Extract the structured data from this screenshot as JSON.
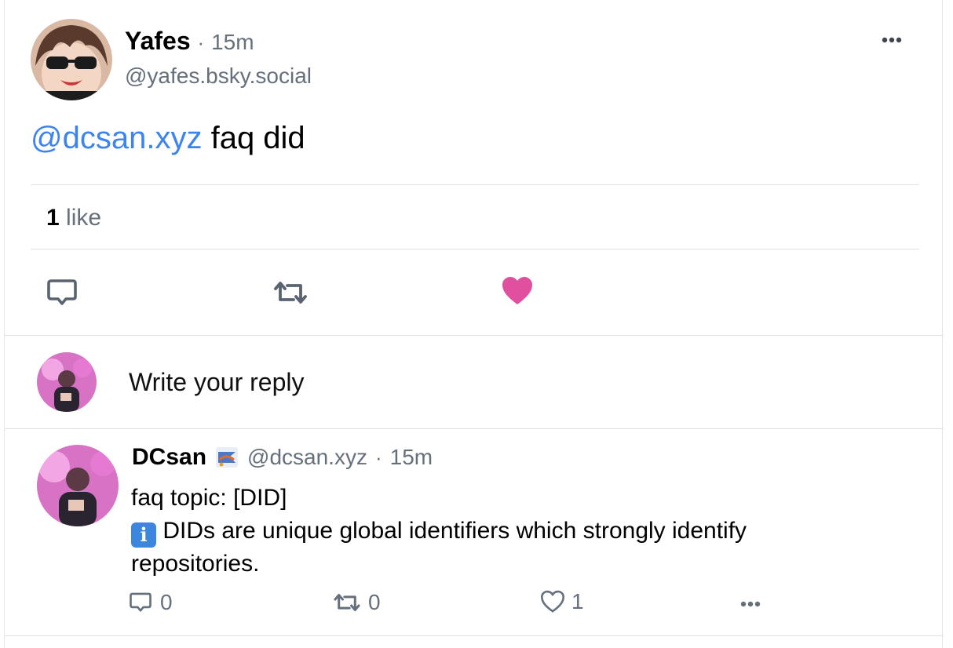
{
  "post": {
    "author_name": "Yafes",
    "separator": "·",
    "time": "15m",
    "handle": "@yafes.bsky.social",
    "mention": "@dcsan.xyz",
    "text": " faq did",
    "like_count": "1",
    "like_label": "like",
    "avatar_icon": "anime-avatar-sunglasses"
  },
  "actions": {
    "reply_icon": "comment-icon",
    "repost_icon": "repost-icon",
    "like_icon": "heart-filled-icon",
    "like_color": "#e0509f",
    "more_icon": "more-horizontal-icon"
  },
  "reply_box": {
    "placeholder": "Write your reply",
    "avatar_icon": "user-avatar"
  },
  "reply": {
    "author_name": "DCsan",
    "badge_icon": "flag-emoji-icon",
    "handle": "@dcsan.xyz",
    "separator": "·",
    "time": "15m",
    "line1": "faq topic: [DID]",
    "info_glyph": "i",
    "line2": " DIDs are unique global identifiers which strongly identify",
    "line3": "repositories.",
    "reply_count": "0",
    "repost_count": "0",
    "like_count": "1"
  },
  "colors": {
    "link": "#3d84ee",
    "muted": "#66707c",
    "divider": "#dfe3e8"
  }
}
